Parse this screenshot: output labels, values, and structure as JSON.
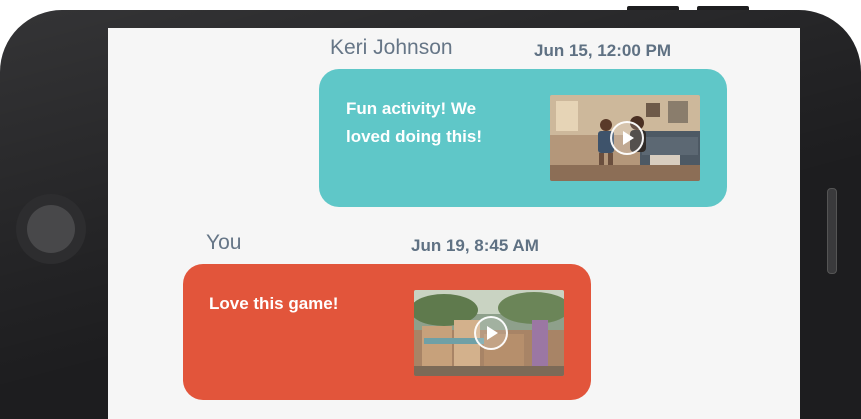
{
  "messages": [
    {
      "sender": "Keri Johnson",
      "time": "Jun 15, 12:00 PM",
      "text": "Fun activity! We loved doing this!",
      "bubble_color": "#5fc7c8",
      "attachment": {
        "type": "video",
        "icon": "play-icon"
      }
    },
    {
      "sender": "You",
      "time": "Jun 19, 8:45 AM",
      "text": "Love this game!",
      "bubble_color": "#e2553b",
      "attachment": {
        "type": "video",
        "icon": "play-icon"
      }
    }
  ]
}
